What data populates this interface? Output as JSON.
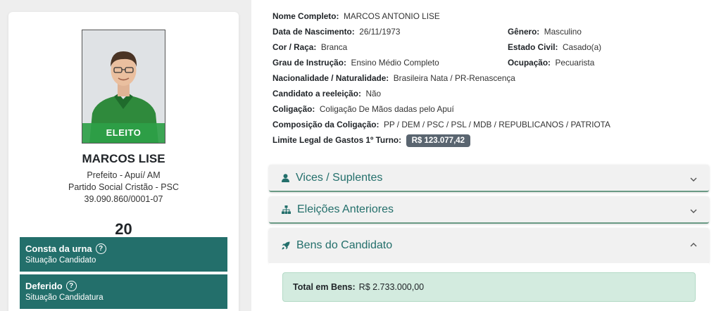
{
  "candidate": {
    "status_overlay": "ELEITO",
    "name": "MARCOS LISE",
    "office": "Prefeito - Apuí/ AM",
    "party": "Partido Social Cristão - PSC",
    "cnpj": "39.090.860/0001-07",
    "number": "20",
    "status_boxes": [
      {
        "title": "Consta da urna",
        "subtitle": "Situação Candidato"
      },
      {
        "title": "Deferido",
        "subtitle": "Situação Candidatura"
      }
    ]
  },
  "details": {
    "full_name": {
      "label": "Nome Completo:",
      "value": "MARCOS ANTONIO LISE"
    },
    "birth": {
      "label": "Data de Nascimento:",
      "value": "26/11/1973"
    },
    "gender": {
      "label": "Gênero:",
      "value": "Masculino"
    },
    "race": {
      "label": "Cor / Raça:",
      "value": "Branca"
    },
    "marital": {
      "label": "Estado Civil:",
      "value": "Casado(a)"
    },
    "education": {
      "label": "Grau de Instrução:",
      "value": "Ensino Médio Completo"
    },
    "occupation": {
      "label": "Ocupação:",
      "value": "Pecuarista"
    },
    "nationality": {
      "label": "Nacionalidade / Naturalidade:",
      "value": "Brasileira Nata / PR-Renascença"
    },
    "reelection": {
      "label": "Candidato a reeleição:",
      "value": "Não"
    },
    "coalition": {
      "label": "Coligação:",
      "value": "Coligação De Mãos dadas pelo Apuí"
    },
    "coalition_parties": {
      "label": "Composição da Coligação:",
      "value": "PP / DEM / PSC / PSL / MDB / REPUBLICANOS / PATRIOTA"
    },
    "spending_limit": {
      "label": "Limite Legal de Gastos 1º Turno:",
      "value": "R$ 123.077,42"
    }
  },
  "accordions": {
    "vices": {
      "title": "Vices / Suplentes",
      "icon": "user-icon"
    },
    "previous": {
      "title": "Eleições Anteriores",
      "icon": "sitemap-icon"
    },
    "assets": {
      "title": "Bens do Candidato",
      "icon": "rocket-icon"
    }
  },
  "assets_total": {
    "label": "Total em Bens:",
    "value": "R$ 2.733.000,00"
  },
  "colors": {
    "teal": "#236f6b",
    "eleito_green": "#2ea048",
    "badge_gray": "#5a6570",
    "total_bg": "#d3ebdf"
  }
}
